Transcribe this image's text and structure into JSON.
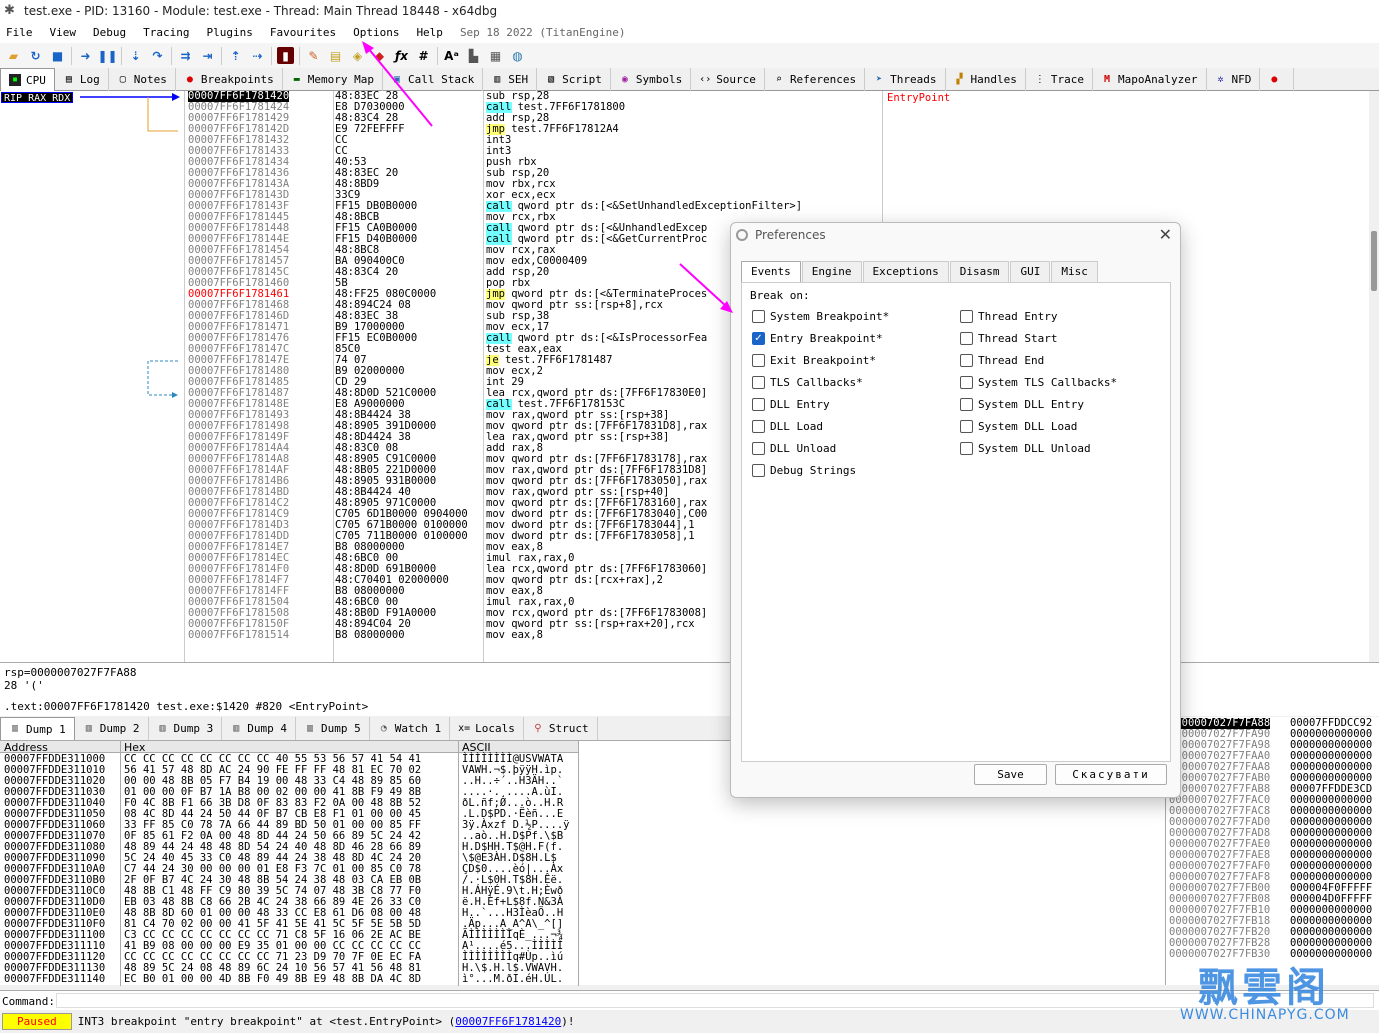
{
  "window": {
    "title": "test.exe - PID: 13160 - Module: test.exe - Thread: Main Thread 18448 - x64dbg"
  },
  "menu": {
    "items": [
      "File",
      "View",
      "Debug",
      "Tracing",
      "Plugins",
      "Favourites",
      "Options",
      "Help"
    ],
    "date": "Sep 18 2022 (TitanEngine)"
  },
  "tabs": [
    "CPU",
    "Log",
    "Notes",
    "Breakpoints",
    "Memory Map",
    "Call Stack",
    "SEH",
    "Script",
    "Symbols",
    "Source",
    "References",
    "Threads",
    "Handles",
    "Trace",
    "MapoAnalyzer",
    "NFD"
  ],
  "registers": {
    "rip_label": "RIP RAX RDX"
  },
  "disasm": {
    "rows": [
      {
        "addr": "00007FF6F1781420",
        "bytes": "48:83EC 28",
        "instr": "sub rsp,28"
      },
      {
        "addr": "00007FF6F1781424",
        "bytes": "E8 D7030000",
        "instr": "call test.7FF6F1781800"
      },
      {
        "addr": "00007FF6F1781429",
        "bytes": "48:83C4 28",
        "instr": "add rsp,28"
      },
      {
        "addr": "00007FF6F178142D",
        "bytes": "E9 72FEFFFF",
        "instr": "jmp test.7FF6F17812A4"
      },
      {
        "addr": "00007FF6F1781432",
        "bytes": "CC",
        "instr": "int3"
      },
      {
        "addr": "00007FF6F1781433",
        "bytes": "CC",
        "instr": "int3"
      },
      {
        "addr": "00007FF6F1781434",
        "bytes": "40:53",
        "instr": "push rbx"
      },
      {
        "addr": "00007FF6F1781436",
        "bytes": "48:83EC 20",
        "instr": "sub rsp,20"
      },
      {
        "addr": "00007FF6F178143A",
        "bytes": "48:8BD9",
        "instr": "mov rbx,rcx"
      },
      {
        "addr": "00007FF6F178143D",
        "bytes": "33C9",
        "instr": "xor ecx,ecx"
      },
      {
        "addr": "00007FF6F178143F",
        "bytes": "FF15 DB0B0000",
        "instr": "call qword ptr ds:[<&SetUnhandledExceptionFilter>]"
      },
      {
        "addr": "00007FF6F1781445",
        "bytes": "48:8BCB",
        "instr": "mov rcx,rbx"
      },
      {
        "addr": "00007FF6F1781448",
        "bytes": "FF15 CA0B0000",
        "instr": "call qword ptr ds:[<&UnhandledExcep"
      },
      {
        "addr": "00007FF6F178144E",
        "bytes": "FF15 D40B0000",
        "instr": "call qword ptr ds:[<&GetCurrentProc"
      },
      {
        "addr": "00007FF6F1781454",
        "bytes": "48:8BC8",
        "instr": "mov rcx,rax"
      },
      {
        "addr": "00007FF6F1781457",
        "bytes": "BA 090400C0",
        "instr": "mov edx,C0000409"
      },
      {
        "addr": "00007FF6F178145C",
        "bytes": "48:83C4 20",
        "instr": "add rsp,20"
      },
      {
        "addr": "00007FF6F1781460",
        "bytes": "5B",
        "instr": "pop rbx"
      },
      {
        "addr": "00007FF6F1781461",
        "bytes": "48:FF25 080C0000",
        "instr": "jmp qword ptr ds:[<&TerminateProces"
      },
      {
        "addr": "00007FF6F1781468",
        "bytes": "48:894C24 08",
        "instr": "mov qword ptr ss:[rsp+8],rcx"
      },
      {
        "addr": "00007FF6F178146D",
        "bytes": "48:83EC 38",
        "instr": "sub rsp,38"
      },
      {
        "addr": "00007FF6F1781471",
        "bytes": "B9 17000000",
        "instr": "mov ecx,17"
      },
      {
        "addr": "00007FF6F1781476",
        "bytes": "FF15 EC0B0000",
        "instr": "call qword ptr ds:[<&IsProcessorFea"
      },
      {
        "addr": "00007FF6F178147C",
        "bytes": "85C0",
        "instr": "test eax,eax"
      },
      {
        "addr": "00007FF6F178147E",
        "bytes": "74 07",
        "instr": "je test.7FF6F1781487"
      },
      {
        "addr": "00007FF6F1781480",
        "bytes": "B9 02000000",
        "instr": "mov ecx,2"
      },
      {
        "addr": "00007FF6F1781485",
        "bytes": "CD 29",
        "instr": "int 29"
      },
      {
        "addr": "00007FF6F1781487",
        "bytes": "48:8D0D 521C0000",
        "instr": "lea rcx,qword ptr ds:[7FF6F17830E0]"
      },
      {
        "addr": "00007FF6F178148E",
        "bytes": "E8 A9000000",
        "instr": "call test.7FF6F178153C"
      },
      {
        "addr": "00007FF6F1781493",
        "bytes": "48:8B4424 38",
        "instr": "mov rax,qword ptr ss:[rsp+38]"
      },
      {
        "addr": "00007FF6F1781498",
        "bytes": "48:8905 391D0000",
        "instr": "mov qword ptr ds:[7FF6F17831D8],rax"
      },
      {
        "addr": "00007FF6F178149F",
        "bytes": "48:8D4424 38",
        "instr": "lea rax,qword ptr ss:[rsp+38]"
      },
      {
        "addr": "00007FF6F17814A4",
        "bytes": "48:83C0 08",
        "instr": "add rax,8"
      },
      {
        "addr": "00007FF6F17814A8",
        "bytes": "48:8905 C91C0000",
        "instr": "mov qword ptr ds:[7FF6F1783178],rax"
      },
      {
        "addr": "00007FF6F17814AF",
        "bytes": "48:8B05 221D0000",
        "instr": "mov rax,qword ptr ds:[7FF6F17831D8]"
      },
      {
        "addr": "00007FF6F17814B6",
        "bytes": "48:8905 931B0000",
        "instr": "mov qword ptr ds:[7FF6F1783050],rax"
      },
      {
        "addr": "00007FF6F17814BD",
        "bytes": "48:8B4424 40",
        "instr": "mov rax,qword ptr ss:[rsp+40]"
      },
      {
        "addr": "00007FF6F17814C2",
        "bytes": "48:8905 971C0000",
        "instr": "mov qword ptr ds:[7FF6F1783160],rax"
      },
      {
        "addr": "00007FF6F17814C9",
        "bytes": "C705 6D1B0000 0904000",
        "instr": "mov dword ptr ds:[7FF6F1783040],C00"
      },
      {
        "addr": "00007FF6F17814D3",
        "bytes": "C705 671B0000 0100000",
        "instr": "mov dword ptr ds:[7FF6F1783044],1"
      },
      {
        "addr": "00007FF6F17814DD",
        "bytes": "C705 711B0000 0100000",
        "instr": "mov dword ptr ds:[7FF6F1783058],1"
      },
      {
        "addr": "00007FF6F17814E7",
        "bytes": "B8 08000000",
        "instr": "mov eax,8"
      },
      {
        "addr": "00007FF6F17814EC",
        "bytes": "48:6BC0 00",
        "instr": "imul rax,rax,0"
      },
      {
        "addr": "00007FF6F17814F0",
        "bytes": "48:8D0D 691B0000",
        "instr": "lea rcx,qword ptr ds:[7FF6F1783060]"
      },
      {
        "addr": "00007FF6F17814F7",
        "bytes": "48:C70401 02000000",
        "instr": "mov qword ptr ds:[rcx+rax],2"
      },
      {
        "addr": "00007FF6F17814FF",
        "bytes": "B8 08000000",
        "instr": "mov eax,8"
      },
      {
        "addr": "00007FF6F1781504",
        "bytes": "48:6BC0 00",
        "instr": "imul rax,rax,0"
      },
      {
        "addr": "00007FF6F1781508",
        "bytes": "48:8B0D F91A0000",
        "instr": "mov rcx,qword ptr ds:[7FF6F1783008]"
      },
      {
        "addr": "00007FF6F178150F",
        "bytes": "48:894C04 20",
        "instr": "mov qword ptr ss:[rsp+rax+20],rcx"
      },
      {
        "addr": "00007FF6F1781514",
        "bytes": "B8 08000000",
        "instr": "mov eax,8"
      }
    ],
    "entry_comment": "EntryPoint"
  },
  "info": {
    "line1": "rsp=0000007027F7FA88",
    "line2": "28 '('",
    "line3": ".text:00007FF6F1781420 test.exe:$1420 #820 <EntryPoint>"
  },
  "dump_tabs": [
    "Dump 1",
    "Dump 2",
    "Dump 3",
    "Dump 4",
    "Dump 5",
    "Watch 1",
    "Locals",
    "Struct"
  ],
  "dump": {
    "headers": {
      "address": "Address",
      "hex": "Hex",
      "ascii": "ASCII"
    },
    "rows": [
      {
        "addr": "00007FFDDE311000",
        "hex": "CC CC CC CC CC CC CC CC 40 55 53 56 57 41 54 41",
        "ascii": "ÌÌÌÌÌÌÌÌ@USVWATA"
      },
      {
        "addr": "00007FFDDE311010",
        "hex": "56 41 57 48 8D AC 24 90 FE FF FF 48 81 EC 70 02",
        "ascii": "VAWH.¬$.þÿÿH.ìp."
      },
      {
        "addr": "00007FFDDE311020",
        "hex": "00 00 48 8B 05 F7 B4 19 00 48 33 C4 48 89 85 60",
        "ascii": "..H..÷´..H3ÄH..`"
      },
      {
        "addr": "00007FFDDE311030",
        "hex": "01 00 00 0F B7 1A B8 00 02 00 00 41 8B F9 49 8B",
        "ascii": "....·.¸....A.ùI."
      },
      {
        "addr": "00007FFDDE311040",
        "hex": "F0 4C 8B F1 66 3B D8 0F 83 83 F2 0A 00 48 8B 52",
        "ascii": "ðL.ñf;Ø...ò..H.R"
      },
      {
        "addr": "00007FFDDE311050",
        "hex": "08 4C 8D 44 24 50 44 0F B7 CB E8 F1 01 00 00 45",
        "ascii": ".L.D$PD.·Ëèñ...E"
      },
      {
        "addr": "00007FFDDE311060",
        "hex": "33 FF 85 C0 78 7A 66 44 89 BD 50 01 00 00 85 FF",
        "ascii": "3ÿ.Àxzf D.½P....ÿ"
      },
      {
        "addr": "00007FFDDE311070",
        "hex": "0F 85 61 F2 0A 00 48 8D 44 24 50 66 89 5C 24 42",
        "ascii": "..aò..H.D$Pf.\\$B"
      },
      {
        "addr": "00007FFDDE311080",
        "hex": "48 89 44 24 48 48 8D 54 24 40 48 8D 46 28 66 89",
        "ascii": "H.D$HH.T$@H.F(f."
      },
      {
        "addr": "00007FFDDE311090",
        "hex": "5C 24 40 45 33 C0 48 89 44 24 38 48 8D 4C 24 20",
        "ascii": "\\$@E3ÀH.D$8H.L$ "
      },
      {
        "addr": "00007FFDDE3110A0",
        "hex": "C7 44 24 30 00 00 00 01 E8 F3 7C 01 00 85 C0 78",
        "ascii": "ÇD$0....èó|...Àx"
      },
      {
        "addr": "00007FFDDE3110B0",
        "hex": "2F 0F B7 4C 24 30 48 8B 54 24 38 48 03 CA EB 0B",
        "ascii": "/.·L$0H.T$8H.Êë."
      },
      {
        "addr": "00007FFDDE3110C0",
        "hex": "48 8B C1 48 FF C9 80 39 5C 74 07 48 3B C8 77 F0",
        "ascii": "H.ÁHÿÉ.9\\t.H;Èwð"
      },
      {
        "addr": "00007FFDDE3110D0",
        "hex": "EB 03 48 8B C8 66 2B 4C 24 38 66 89 4E 26 33 C0",
        "ascii": "ë.H.Èf+L$8f.N&3À"
      },
      {
        "addr": "00007FFDDE3110E0",
        "hex": "48 8B 8D 60 01 00 00 48 33 CC E8 61 D6 08 00 48",
        "ascii": "H..`...H3ÌèaÖ..H"
      },
      {
        "addr": "00007FFDDE3110F0",
        "hex": "81 C4 70 02 00 00 41 5F 41 5E 41 5C 5F 5E 5B 5D",
        "ascii": ".Äp...A_A^A\\_^[]"
      },
      {
        "addr": "00007FFDDE311100",
        "hex": "C3 CC CC CC CC CC CC CC 71 C8 5F 16 06 2E AC BE",
        "ascii": "ÃÌÌÌÌÌÌÌqÈ_...¬¾"
      },
      {
        "addr": "00007FFDDE311110",
        "hex": "41 B9 08 00 00 00 E9 35 01 00 00 CC CC CC CC CC",
        "ascii": "A¹....é5...ÌÌÌÌÌ"
      },
      {
        "addr": "00007FFDDE311120",
        "hex": "CC CC CC CC CC CC CC CC 71 23 D9 70 7F 0E EC FA",
        "ascii": "ÌÌÌÌÌÌÌÌq#Ùp..ìú"
      },
      {
        "addr": "00007FFDDE311130",
        "hex": "48 89 5C 24 08 48 89 6C 24 10 56 57 41 56 48 81",
        "ascii": "H.\\$.H.l$.VWAVH."
      },
      {
        "addr": "00007FFDDE311140",
        "hex": "EC B0 01 00 00 4D 8B F0 49 8B E9 48 8B DA 4C 8D",
        "ascii": "ì°...M.ðI.éH.ÚL."
      }
    ]
  },
  "stack": {
    "rows": [
      {
        "addr": "0000007027F7FA88",
        "val": "00007FFDDCC92"
      },
      {
        "addr": "0000007027F7FA90",
        "val": "0000000000000"
      },
      {
        "addr": "0000007027F7FA98",
        "val": "0000000000000"
      },
      {
        "addr": "0000007027F7FAA0",
        "val": "0000000000000"
      },
      {
        "addr": "0000007027F7FAA8",
        "val": "0000000000000"
      },
      {
        "addr": "0000007027F7FAB0",
        "val": "0000000000000"
      },
      {
        "addr": "0000007027F7FAB8",
        "val": "00007FFDDE3CD"
      },
      {
        "addr": "0000007027F7FAC0",
        "val": "0000000000000"
      },
      {
        "addr": "0000007027F7FAC8",
        "val": "0000000000000"
      },
      {
        "addr": "0000007027F7FAD0",
        "val": "0000000000000"
      },
      {
        "addr": "0000007027F7FAD8",
        "val": "0000000000000"
      },
      {
        "addr": "0000007027F7FAE0",
        "val": "0000000000000"
      },
      {
        "addr": "0000007027F7FAE8",
        "val": "0000000000000"
      },
      {
        "addr": "0000007027F7FAF0",
        "val": "0000000000000"
      },
      {
        "addr": "0000007027F7FAF8",
        "val": "0000000000000"
      },
      {
        "addr": "0000007027F7FB00",
        "val": "000004F0FFFFF"
      },
      {
        "addr": "0000007027F7FB08",
        "val": "000004D0FFFFF"
      },
      {
        "addr": "0000007027F7FB10",
        "val": "0000000000000"
      },
      {
        "addr": "0000007027F7FB18",
        "val": "0000000000000"
      },
      {
        "addr": "0000007027F7FB20",
        "val": "0000000000000"
      },
      {
        "addr": "0000007027F7FB28",
        "val": "0000000000000"
      },
      {
        "addr": "0000007027F7FB30",
        "val": "0000000000000"
      }
    ]
  },
  "command": {
    "label": "Command:"
  },
  "status": {
    "state": "Paused",
    "text": "INT3  breakpoint  \"entry  breakpoint\"  at  <test.EntryPoint>  (",
    "link": "00007FF6F1781420",
    "tail": ")!"
  },
  "prefs": {
    "title": "Preferences",
    "tabs": [
      "Events",
      "Engine",
      "Exceptions",
      "Disasm",
      "GUI",
      "Misc"
    ],
    "break_on": "Break on:",
    "left": [
      {
        "label": "System Breakpoint*",
        "checked": false
      },
      {
        "label": "Entry Breakpoint*",
        "checked": true
      },
      {
        "label": "Exit Breakpoint*",
        "checked": false
      },
      {
        "label": "TLS Callbacks*",
        "checked": false
      },
      {
        "label": "DLL Entry",
        "checked": false
      },
      {
        "label": "DLL Load",
        "checked": false
      },
      {
        "label": "DLL Unload",
        "checked": false
      },
      {
        "label": "Debug Strings",
        "checked": false
      }
    ],
    "right": [
      {
        "label": "Thread Entry",
        "checked": false
      },
      {
        "label": "Thread Start",
        "checked": false
      },
      {
        "label": "Thread End",
        "checked": false
      },
      {
        "label": "System TLS Callbacks*",
        "checked": false
      },
      {
        "label": "System DLL Entry",
        "checked": false
      },
      {
        "label": "System DLL Load",
        "checked": false
      },
      {
        "label": "System DLL Unload",
        "checked": false
      }
    ],
    "save": "Save",
    "cancel": "Скасувати"
  },
  "watermark": {
    "big": "飘雲阁",
    "small": "WWW.CHINAPYG.COM"
  },
  "colors": {
    "accent": "#1a64c8",
    "paused_bg": "#ffff00",
    "call_bg": "#00ffff",
    "jmp_bg": "#ffff00"
  }
}
